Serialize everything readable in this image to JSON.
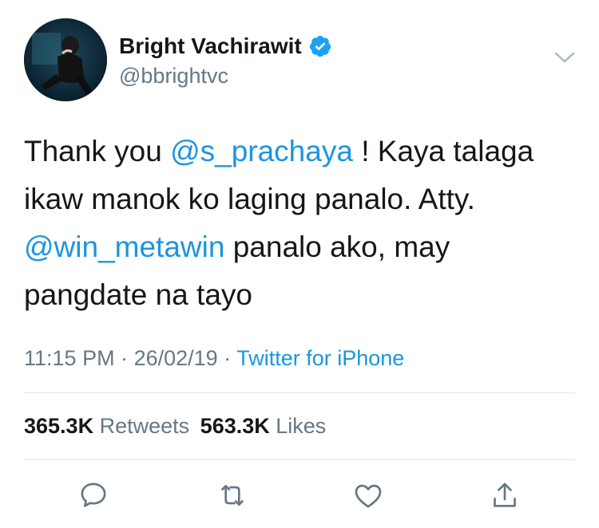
{
  "user": {
    "display_name": "Bright Vachirawit",
    "handle": "@bbrightvc",
    "verified": true
  },
  "tweet": {
    "text_1": "Thank you ",
    "mention_1": "@s_prachaya",
    "text_2": " ! Kaya talaga ikaw manok ko laging panalo. Atty. ",
    "mention_2": "@win_metawin",
    "text_3": " panalo ako, may pangdate na tayo"
  },
  "meta": {
    "time": "11:15 PM",
    "separator_1": " · ",
    "date": "26/02/19",
    "separator_2": " · ",
    "source": "Twitter for iPhone"
  },
  "stats": {
    "retweets_count": "365.3K",
    "retweets_label": "Retweets",
    "likes_count": "563.3K",
    "likes_label": "Likes"
  },
  "colors": {
    "link": "#1b95e0",
    "secondary_text": "#657786",
    "primary_text": "#14171a",
    "divider": "#e1e8ed",
    "verified_badge": "#1da1f2"
  },
  "icons": {
    "menu": "chevron-down-icon",
    "verified": "verified-badge-icon",
    "reply": "reply-icon",
    "retweet": "retweet-icon",
    "like": "heart-icon",
    "share": "share-icon"
  }
}
